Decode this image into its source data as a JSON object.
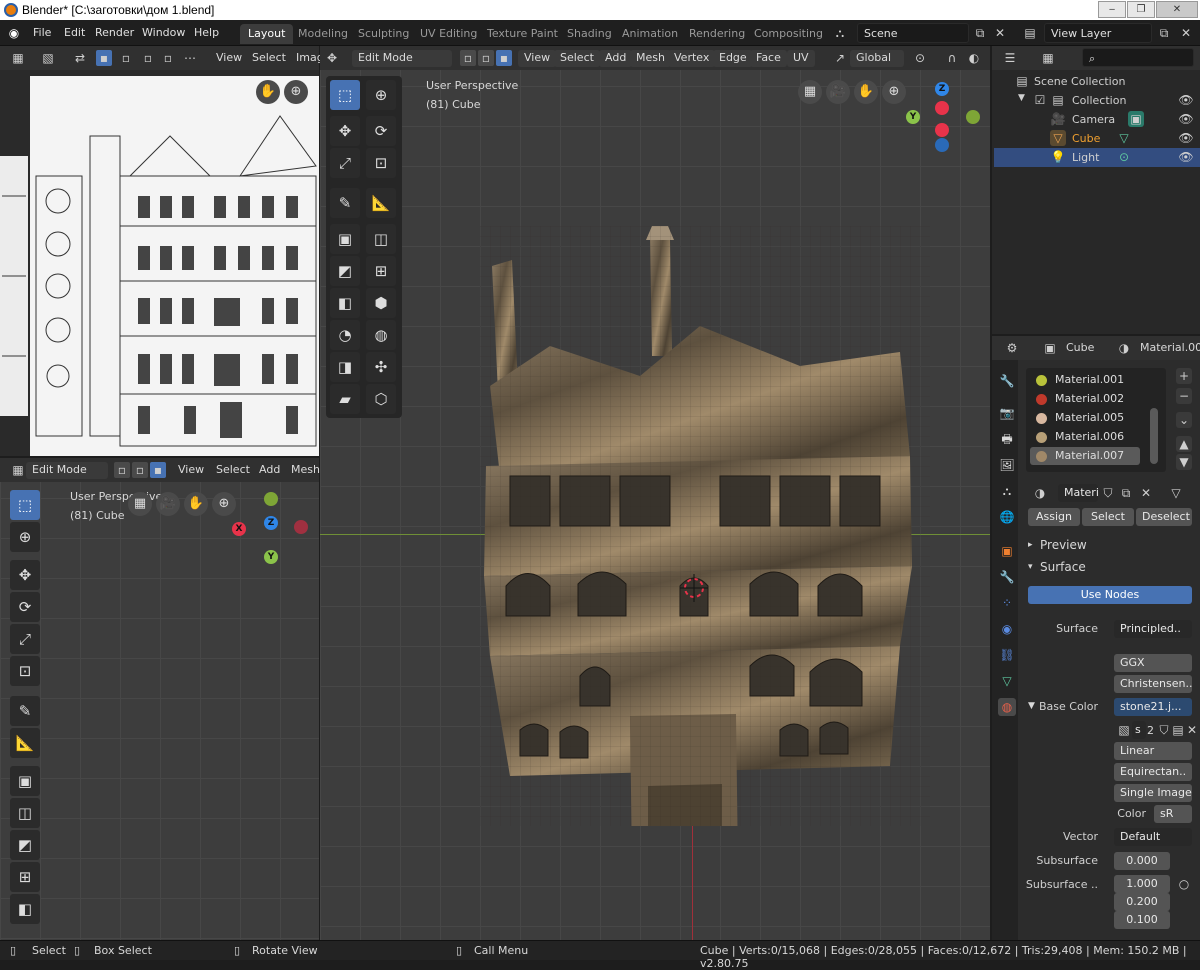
{
  "window": {
    "title": "Blender* [C:\\заготовки\\дом 1.blend]"
  },
  "menu": [
    "File",
    "Edit",
    "Render",
    "Window",
    "Help"
  ],
  "workspaces": [
    "Layout",
    "Modeling",
    "Sculpting",
    "UV Editing",
    "Texture Paint",
    "Shading",
    "Animation",
    "Rendering",
    "Compositing"
  ],
  "scene_field": "Scene",
  "view_layer_field": "View Layer",
  "image_editor": {
    "header": {
      "view": "View",
      "select": "Select",
      "image": "Imag"
    }
  },
  "main_viewport": {
    "mode": "Edit Mode",
    "menus": [
      "View",
      "Select",
      "Add",
      "Mesh",
      "Vertex",
      "Edge",
      "Face",
      "UV"
    ],
    "orientation": "Global",
    "overlay_title": "User Perspective",
    "overlay_object": "(81) Cube",
    "gizmo": {
      "z": "Z",
      "y": "Y"
    }
  },
  "small_viewport": {
    "mode": "Edit Mode",
    "menus": [
      "View",
      "Select",
      "Add",
      "Mesh"
    ],
    "overlay_title": "User Perspective",
    "overlay_object": "(81) Cube",
    "gizmo": {
      "x": "X",
      "y": "Y",
      "z": "Z"
    }
  },
  "outliner": {
    "search_placeholder": "",
    "rows": [
      {
        "label": "Scene Collection",
        "icon": "collection-icon"
      },
      {
        "label": "Collection",
        "icon": "collection-icon"
      },
      {
        "label": "Camera",
        "icon": "camera-icon"
      },
      {
        "label": "Cube",
        "icon": "mesh-icon"
      },
      {
        "label": "Light",
        "icon": "light-icon"
      }
    ]
  },
  "properties": {
    "object_name": "Cube",
    "material_name": "Material.007",
    "materials": [
      {
        "name": "Material.001",
        "color": "#b9c23a"
      },
      {
        "name": "Material.002",
        "color": "#c0392b"
      },
      {
        "name": "Material.005",
        "color": "#d8b8a0"
      },
      {
        "name": "Material.006",
        "color": "#b8a078"
      },
      {
        "name": "Material.007",
        "color": "#a08868"
      }
    ],
    "slot_material": "Materi",
    "buttons": {
      "assign": "Assign",
      "select": "Select",
      "deselect": "Deselect"
    },
    "sections": {
      "preview": "Preview",
      "surface": "Surface"
    },
    "use_nodes": "Use Nodes",
    "rows": {
      "surface_label": "Surface",
      "surface_value": "Principled..",
      "distribution": "GGX",
      "subsurface_method": "Christensen..",
      "base_color_label": "Base Color",
      "base_color_value": "stone21.j...",
      "image_short": "s",
      "image_users": "2",
      "interpolation": "Linear",
      "projection": "Equirectan..",
      "source": "Single Image",
      "color_label": "Color",
      "color_space": "sR",
      "vector_label": "Vector",
      "vector_value": "Default",
      "subsurface_label": "Subsurface",
      "subsurface_value": "0.000",
      "subsurface_radius_label": "Subsurface ..",
      "radius_values": [
        "1.000",
        "0.200",
        "0.100"
      ]
    }
  },
  "statusbar": {
    "select": "Select",
    "box_select": "Box Select",
    "rotate": "Rotate View",
    "call_menu": "Call Menu",
    "stats": "Cube | Verts:0/15,068 | Edges:0/28,055 | Faces:0/12,672 | Tris:29,408 | Mem: 150.2 MB | v2.80.75"
  },
  "colors": {
    "accent": "#4772b3",
    "selected_row": "#334d80",
    "x_axis": "#e8334a",
    "y_axis": "#8bc34a",
    "z_axis": "#2f86e8"
  }
}
